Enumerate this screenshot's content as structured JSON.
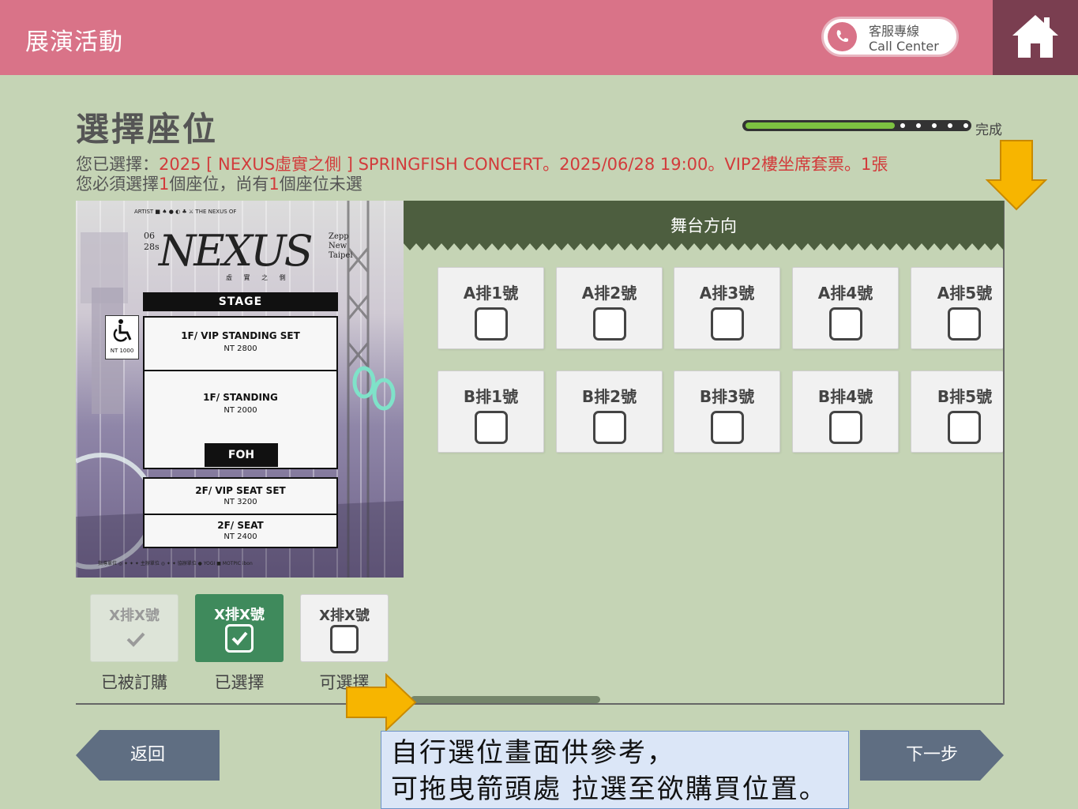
{
  "header": {
    "title": "展演活動",
    "call_center_line1": "客服專線",
    "call_center_line2": "Call Center"
  },
  "page_title": "選擇座位",
  "progress": {
    "label": "完成",
    "fill_fraction": 0.65
  },
  "selection_info": {
    "prefix": "您已選擇：",
    "detail": "2025 [ NEXUS虛實之側 ] SPRINGFISH CONCERT。2025/06/28 19:00。VIP2樓坐席套票。1張",
    "must_prefix": "您必須選擇",
    "must_count": "1",
    "must_mid": "個座位，尚有",
    "remain_count": "1",
    "must_suffix": "個座位未選"
  },
  "poster": {
    "topline": "ARTIST    ■ ♠ ● ◐ ♣ ⚔    THE NEXUS OF",
    "logo": "NEXUS",
    "subtitle": "虛 實 之 側",
    "date_line1": "06",
    "date_line2": "28s",
    "venue_line1": "Zepp",
    "venue_line2": "New",
    "venue_line3": "Taipei",
    "stage": "STAGE",
    "wheelchair_price": "NT 1000",
    "zones": [
      {
        "name": "1F/ VIP STANDING SET",
        "price": "NT 2800"
      },
      {
        "name": "1F/ STANDING",
        "price": "NT 2000"
      },
      {
        "name": "2F/ VIP SEAT SET",
        "price": "NT 3200"
      },
      {
        "name": "2F/ SEAT",
        "price": "NT 2400"
      }
    ],
    "foh": "FOH",
    "sponsors": "指導單位 ◎ ✦ ✦ ✦   主辦單位 ◎ ✦ ✦   協辦單位 ● YOGI  ■ MOTPIC  ibon"
  },
  "stage_direction": "舞台方向",
  "seats": [
    [
      "A排1號",
      "A排2號",
      "A排3號",
      "A排4號",
      "A排5號"
    ],
    [
      "B排1號",
      "B排2號",
      "B排3號",
      "B排4號",
      "B排5號"
    ]
  ],
  "legend": {
    "sample_label": "X排X號",
    "booked": "已被訂購",
    "selected": "已選擇",
    "available": "可選擇"
  },
  "buttons": {
    "back": "返回",
    "next": "下一步"
  },
  "note": {
    "line1": "自行選位畫面供參考，",
    "line2": "可拖曳箭頭處 拉選至欲購買位置。"
  },
  "colors": {
    "header_bg": "#d97388",
    "home_bg": "#7a3e50",
    "page_bg": "#c5d4b5",
    "stage_bar": "#4d5e3f",
    "selected_green": "#3f8a5c",
    "highlight_red": "#d23b3b",
    "arrow_yellow": "#f7b500"
  }
}
